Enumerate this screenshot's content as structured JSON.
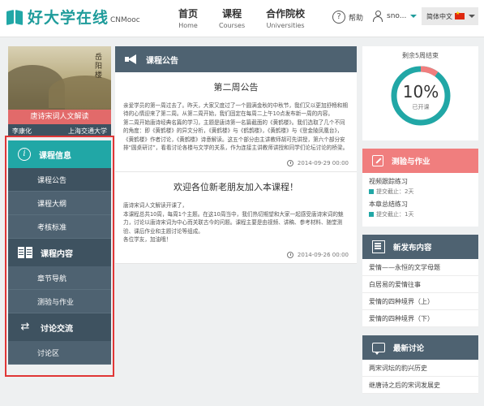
{
  "header": {
    "logo_text": "好大学在线",
    "logo_sub": "CNMooc",
    "nav": [
      {
        "cn": "首页",
        "en": "Home"
      },
      {
        "cn": "课程",
        "en": "Courses"
      },
      {
        "cn": "合作院校",
        "en": "Universities"
      }
    ],
    "help_label": "帮助",
    "help_icon": "?",
    "user_name": "sno...",
    "lang_label": "简体中文"
  },
  "course": {
    "poem": "岳阳楼",
    "title": "唐诗宋词人文解读",
    "teacher": "李康化",
    "school": "上海交通大学"
  },
  "sidebar": {
    "sections": [
      {
        "label": "课程信息",
        "icon": "info-icon",
        "items": [
          "课程公告",
          "课程大纲",
          "考核标准"
        ]
      },
      {
        "label": "课程内容",
        "icon": "book-icon",
        "items": [
          "章节导航",
          "测验与作业"
        ]
      },
      {
        "label": "讨论交流",
        "icon": "swap-icon",
        "items": [
          "讨论区"
        ]
      }
    ],
    "active_item": "课程公告"
  },
  "announcements": {
    "header": "课程公告",
    "items": [
      {
        "title": "第二周公告",
        "body": "    亲爱学员的第一周过去了。昨天，大家又度过了一个圆满金秋的中秋节，我们又以更加舒畅和期待的心情迎来了第二周。从第二周开始，我们固定在每周二上午10点发布新一周的内容。\n    第二周开始唐诗经典名篇的学习，主题是唐诗第一名篇截面的《黄鹤楼》。我们选取了几个不同的角度：即《黄鹤楼》的异文分析，《黄鹤楼》与《鹤鹊楼》，《黄鹤楼》与《登金陵凤凰台》，《黄鹤楼》作者讨论，《黄鹤楼》诗意解读。这五个部分由主讲教师胡可先讲授，第六个部分安排“圆桌研讨”，看看讨论各楼与文学的关系，作为连接主讲教师讲授和同学们论坛讨论的桥梁。",
        "date": "2014-09-29 00:00"
      },
      {
        "title": "欢迎各位新老朋友加入本课程！",
        "body": "唐诗宋词人文解读开课了，\n本课程总共10周，每周1个主题。在这10周当中，我们热切期望和大家一起感受唐诗宋词的魅力，讨论以唐诗宋词为中心而关联古今的问题。课程主要是由视频、讲稿、参考材料、随堂测验、课后作业和主题讨论等组成。\n各位学友，加油哦！",
        "date": "2014-09-26 00:00"
      }
    ]
  },
  "progress": {
    "remaining_label": "剩余5周结束",
    "percent": 10,
    "percent_label": "10%",
    "status": "已开课",
    "ring_color": "#21a7a6",
    "rest_color": "#f07e7e"
  },
  "quiz": {
    "header": "测验与作业",
    "items": [
      {
        "name": "视频跟踪练习",
        "deadline": "提交截止：2天"
      },
      {
        "name": "本章总结练习",
        "deadline": "提交截止：1天"
      }
    ]
  },
  "posts": {
    "header": "新发布内容",
    "items": [
      "爱情——永恒的文学母题",
      "白居易的爱情往事",
      "爱情的四种境界（上）",
      "爱情的四种境界（下）"
    ]
  },
  "discussion": {
    "header": "最新讨论",
    "items": [
      "两宋词坛的豹兴历史",
      "继唐诗之后的宋词发展史"
    ]
  },
  "colors": {
    "accent": "#21a7a6",
    "slate": "#4e6271",
    "highlight": "#e03636"
  }
}
